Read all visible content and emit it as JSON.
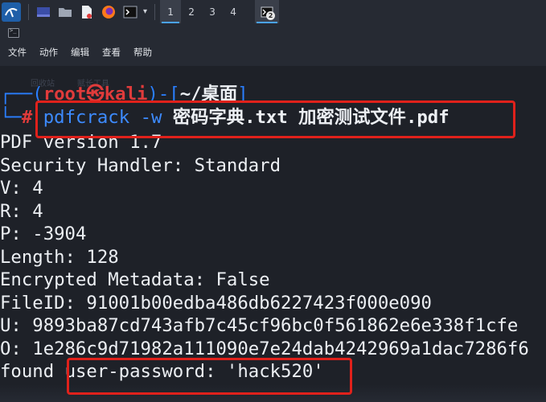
{
  "taskbar": {
    "workspaces": [
      "1",
      "2",
      "3",
      "4"
    ],
    "active_workspace": "1",
    "terminal_badge": "2"
  },
  "window": {
    "menu": [
      "文件",
      "动作",
      "编辑",
      "查看",
      "帮助"
    ],
    "ghost_labels": [
      "回收站",
      "赋长工具"
    ]
  },
  "terminal": {
    "prompt_user": "root",
    "prompt_at": "㉿",
    "prompt_host": "kali",
    "prompt_dir": "~/桌面",
    "prompt_symbol": "#",
    "command_name": "pdfcrack",
    "command_flag": "-w",
    "command_args": "密码字典.txt 加密测试文件.pdf",
    "output": [
      "PDF version 1.7",
      "Security Handler: Standard",
      "V: 4",
      "R: 4",
      "P: -3904",
      "Length: 128",
      "Encrypted Metadata: False",
      "FileID: 91001b00edba486db6227423f000e090",
      "U: 9893ba87cd743afb7c45cf96bc0f561862e6e338f1cfe",
      "O: 1e286c9d71982a111090e7e24dab4242969a1dac7286f6"
    ],
    "found_prefix": "found",
    "found_text": "user-password: 'hack520'"
  },
  "colors": {
    "prompt_blue": "#2a7fff",
    "prompt_red": "#e03b3b",
    "highlight_box": "#e0211b",
    "terminal_bg": "#1e2128"
  }
}
